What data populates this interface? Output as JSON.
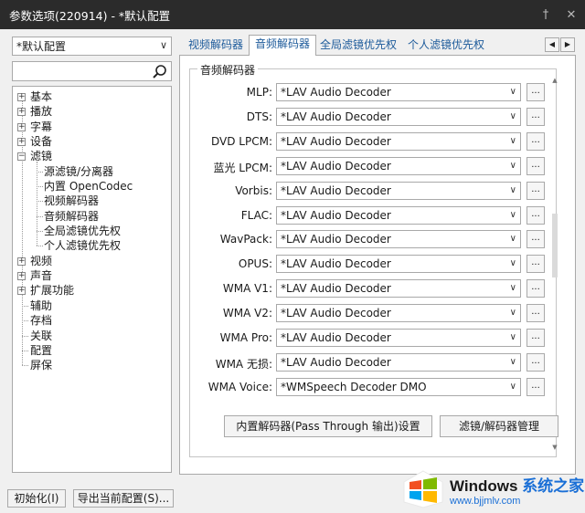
{
  "window": {
    "title": "参数选项(220914) - *默认配置",
    "pin_glyph": "†",
    "close_glyph": "✕"
  },
  "left": {
    "preset_value": "*默认配置",
    "search_placeholder": "",
    "tree": [
      {
        "label": "基本",
        "expander": "+",
        "level": 0
      },
      {
        "label": "播放",
        "expander": "+",
        "level": 0
      },
      {
        "label": "字幕",
        "expander": "+",
        "level": 0
      },
      {
        "label": "设备",
        "expander": "+",
        "level": 0
      },
      {
        "label": "滤镜",
        "expander": "-",
        "level": 0
      },
      {
        "label": "源滤镜/分离器",
        "expander": "",
        "level": 1
      },
      {
        "label": "内置 OpenCodec",
        "expander": "",
        "level": 1
      },
      {
        "label": "视频解码器",
        "expander": "",
        "level": 1
      },
      {
        "label": "音频解码器",
        "expander": "",
        "level": 1
      },
      {
        "label": "全局滤镜优先权",
        "expander": "",
        "level": 1
      },
      {
        "label": "个人滤镜优先权",
        "expander": "",
        "level": 1
      },
      {
        "label": "视频",
        "expander": "+",
        "level": 0
      },
      {
        "label": "声音",
        "expander": "+",
        "level": 0
      },
      {
        "label": "扩展功能",
        "expander": "+",
        "level": 0
      },
      {
        "label": "辅助",
        "expander": "",
        "level": 0
      },
      {
        "label": "存档",
        "expander": "",
        "level": 0
      },
      {
        "label": "关联",
        "expander": "",
        "level": 0
      },
      {
        "label": "配置",
        "expander": "",
        "level": 0
      },
      {
        "label": "屏保",
        "expander": "",
        "level": 0
      }
    ]
  },
  "tabs": [
    {
      "label": "视频解码器",
      "active": false
    },
    {
      "label": "音频解码器",
      "active": true
    },
    {
      "label": "全局滤镜优先权",
      "active": false
    },
    {
      "label": "个人滤镜优先权",
      "active": false
    }
  ],
  "tab_scroll": {
    "left": "◀",
    "right": "▶"
  },
  "group_title": "音频解码器",
  "decoders": [
    {
      "label": "MLP:",
      "value": "*LAV Audio Decoder"
    },
    {
      "label": "DTS:",
      "value": "*LAV Audio Decoder"
    },
    {
      "label": "DVD LPCM:",
      "value": "*LAV Audio Decoder"
    },
    {
      "label": "蓝光 LPCM:",
      "value": "*LAV Audio Decoder"
    },
    {
      "label": "Vorbis:",
      "value": "*LAV Audio Decoder"
    },
    {
      "label": "FLAC:",
      "value": "*LAV Audio Decoder"
    },
    {
      "label": "WavPack:",
      "value": "*LAV Audio Decoder"
    },
    {
      "label": "OPUS:",
      "value": "*LAV Audio Decoder"
    },
    {
      "label": "WMA V1:",
      "value": "*LAV Audio Decoder"
    },
    {
      "label": "WMA V2:",
      "value": "*LAV Audio Decoder"
    },
    {
      "label": "WMA Pro:",
      "value": "*LAV Audio Decoder"
    },
    {
      "label": "WMA 无损:",
      "value": "*LAV Audio Decoder"
    },
    {
      "label": "WMA Voice:",
      "value": "*WMSpeech Decoder DMO"
    }
  ],
  "more_button_label": "...",
  "buttons": {
    "passthrough": "内置解码器(Pass Through 输出)设置",
    "manager": "滤镜/解码器管理"
  },
  "bottom": {
    "init": "初始化(I)",
    "export": "导出当前配置(S)..."
  },
  "watermark": {
    "brand": "Windows",
    "brand_cn": "系统之家",
    "url": "www.bjjmlv.com"
  }
}
